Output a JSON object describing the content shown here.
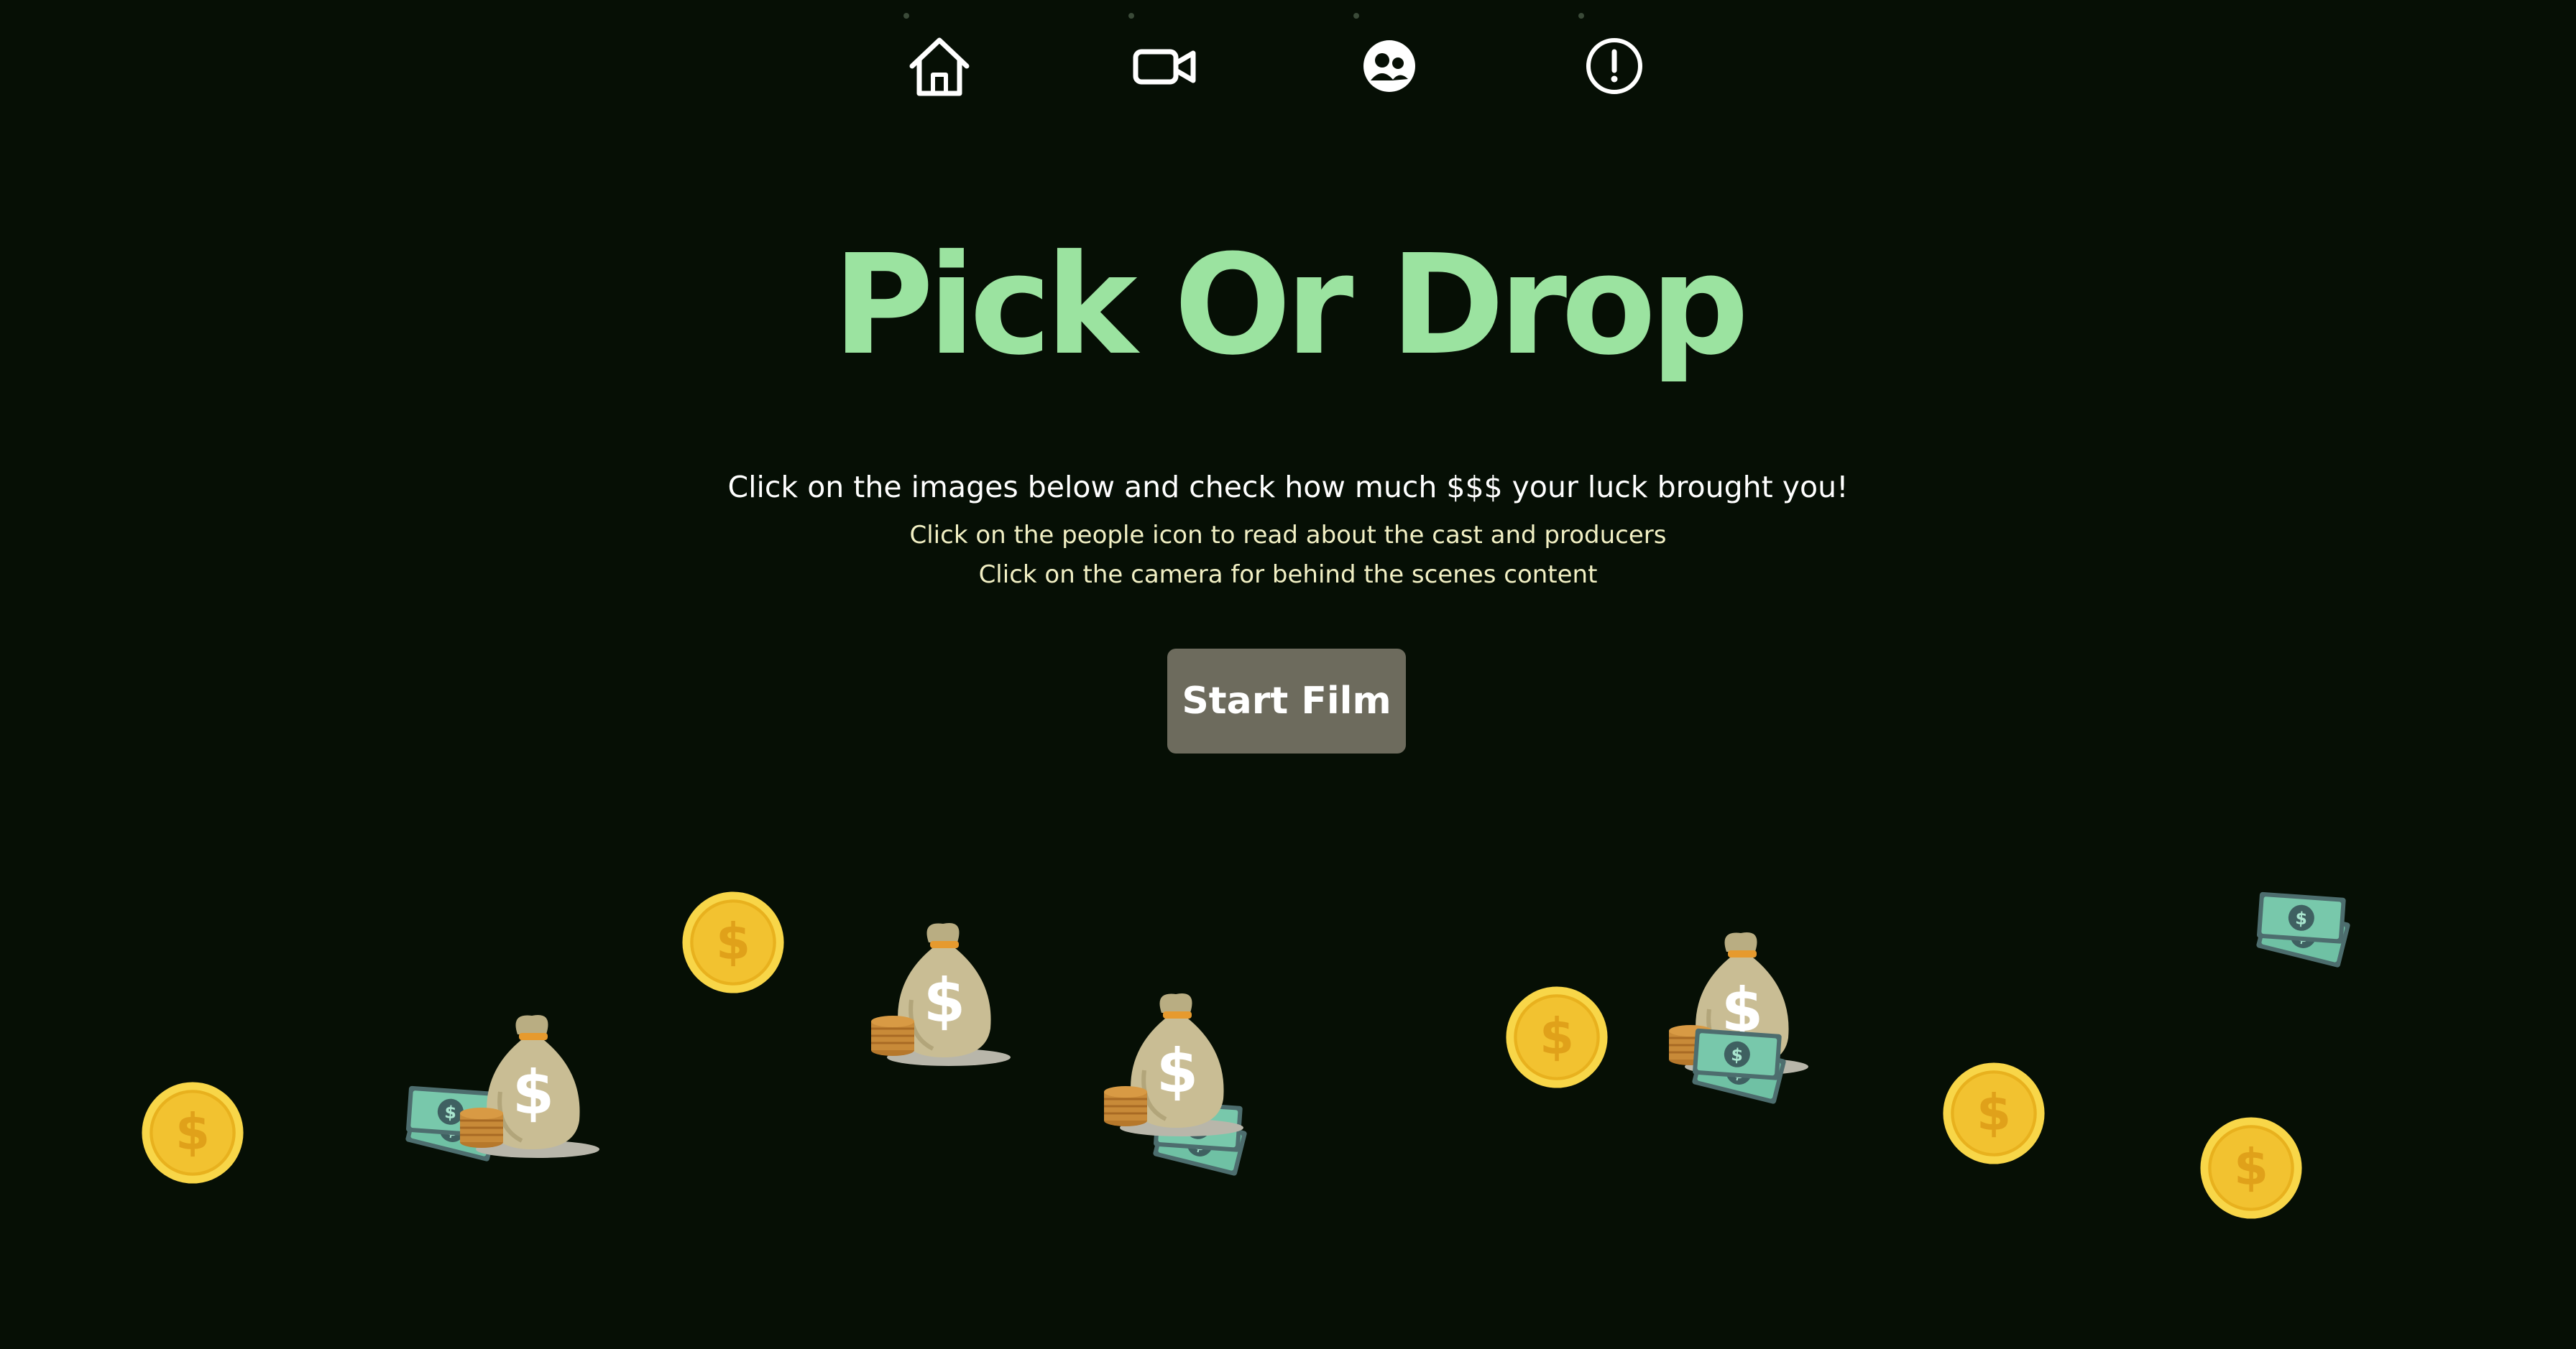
{
  "nav": {
    "items": [
      {
        "id": "home",
        "icon": "home-icon"
      },
      {
        "id": "video",
        "icon": "video-camera-icon"
      },
      {
        "id": "people",
        "icon": "people-icon"
      },
      {
        "id": "info",
        "icon": "exclamation-circle-icon"
      }
    ],
    "icon_color": "#ffffff"
  },
  "hero": {
    "title": "Pick Or Drop",
    "intro": "Click on the images below and check how much $$$ your luck brought you!",
    "hint_people": "Click on the people icon to read about the cast and producers",
    "hint_camera": "Click on the camera for behind the scenes content",
    "start_button": "Start Film"
  },
  "prizes": [
    {
      "type": "coin",
      "icon": "gold-coin-icon"
    },
    {
      "type": "bag-with-cash",
      "icon": "money-bag-icon"
    },
    {
      "type": "coin",
      "icon": "gold-coin-icon"
    },
    {
      "type": "bag",
      "icon": "money-bag-icon"
    },
    {
      "type": "bag-with-cash",
      "icon": "money-bag-icon"
    },
    {
      "type": "coin",
      "icon": "gold-coin-icon"
    },
    {
      "type": "bag-with-cash",
      "icon": "money-bag-icon"
    },
    {
      "type": "coin",
      "icon": "gold-coin-icon"
    },
    {
      "type": "cash",
      "icon": "cash-stack-icon"
    },
    {
      "type": "coin",
      "icon": "gold-coin-icon"
    }
  ],
  "colors": {
    "background": "#060f05",
    "title": "#9be3a0",
    "intro_text": "#ffffff",
    "hint_text": "#f2f0c4",
    "button_bg": "#6d6b5d",
    "coin": "#f4c430",
    "bag": "#c9bd94",
    "cash": "#5fae93"
  }
}
